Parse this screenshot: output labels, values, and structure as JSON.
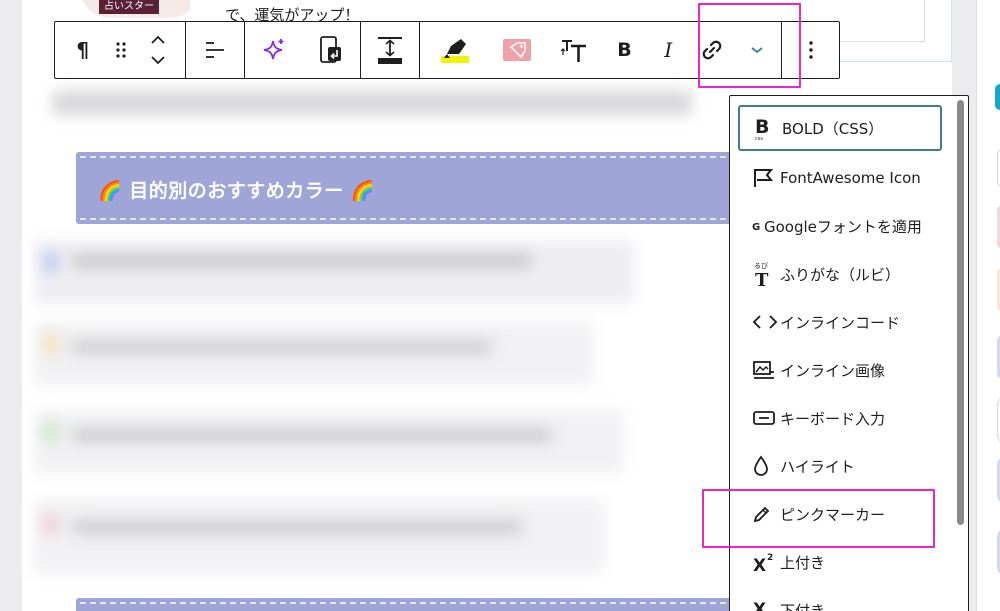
{
  "editor": {
    "paragraph_text": "で、運気がアップ！",
    "avatar_badge": "占いスター",
    "section_heading": "🌈 目的別のおすすめカラー 🌈"
  },
  "toolbar": {
    "paragraph_glyph": "¶",
    "bold_label": "B",
    "italic_label": "I",
    "buttons": [
      "paragraph-block-type",
      "drag-handle",
      "move-up-down",
      "align",
      "ai-sparkle",
      "mobile-return",
      "spacing",
      "marker-highlight",
      "tag-label",
      "text-size",
      "bold",
      "italic",
      "link",
      "more-rich-text-dropdown",
      "block-options"
    ]
  },
  "dropdown": {
    "items": [
      {
        "label": "BOLD（CSS）",
        "icon": "bold-css-icon"
      },
      {
        "label": "FontAwesome Icon",
        "icon": "flag-icon"
      },
      {
        "label": "Googleフォントを適用",
        "icon": "google-font-icon"
      },
      {
        "label": "ふりがな（ルビ）",
        "icon": "ruby-icon"
      },
      {
        "label": "インラインコード",
        "icon": "code-icon"
      },
      {
        "label": "インライン画像",
        "icon": "image-icon"
      },
      {
        "label": "キーボード入力",
        "icon": "keyboard-icon"
      },
      {
        "label": "ハイライト",
        "icon": "drop-icon"
      },
      {
        "label": "ピンクマーカー",
        "icon": "pencil-icon"
      },
      {
        "label": "上付き",
        "icon": "superscript-icon"
      },
      {
        "label": "下付き",
        "icon": "subscript-icon"
      }
    ]
  },
  "colors": {
    "banner": "#9fa6d7",
    "highlight_annotation": "#ee25c9",
    "focus_ring": "#3e7e95",
    "ai_sparkle": "#8a2be2",
    "marker_yellow": "#f4f20b",
    "tag_pink": "#f0a2a9"
  }
}
